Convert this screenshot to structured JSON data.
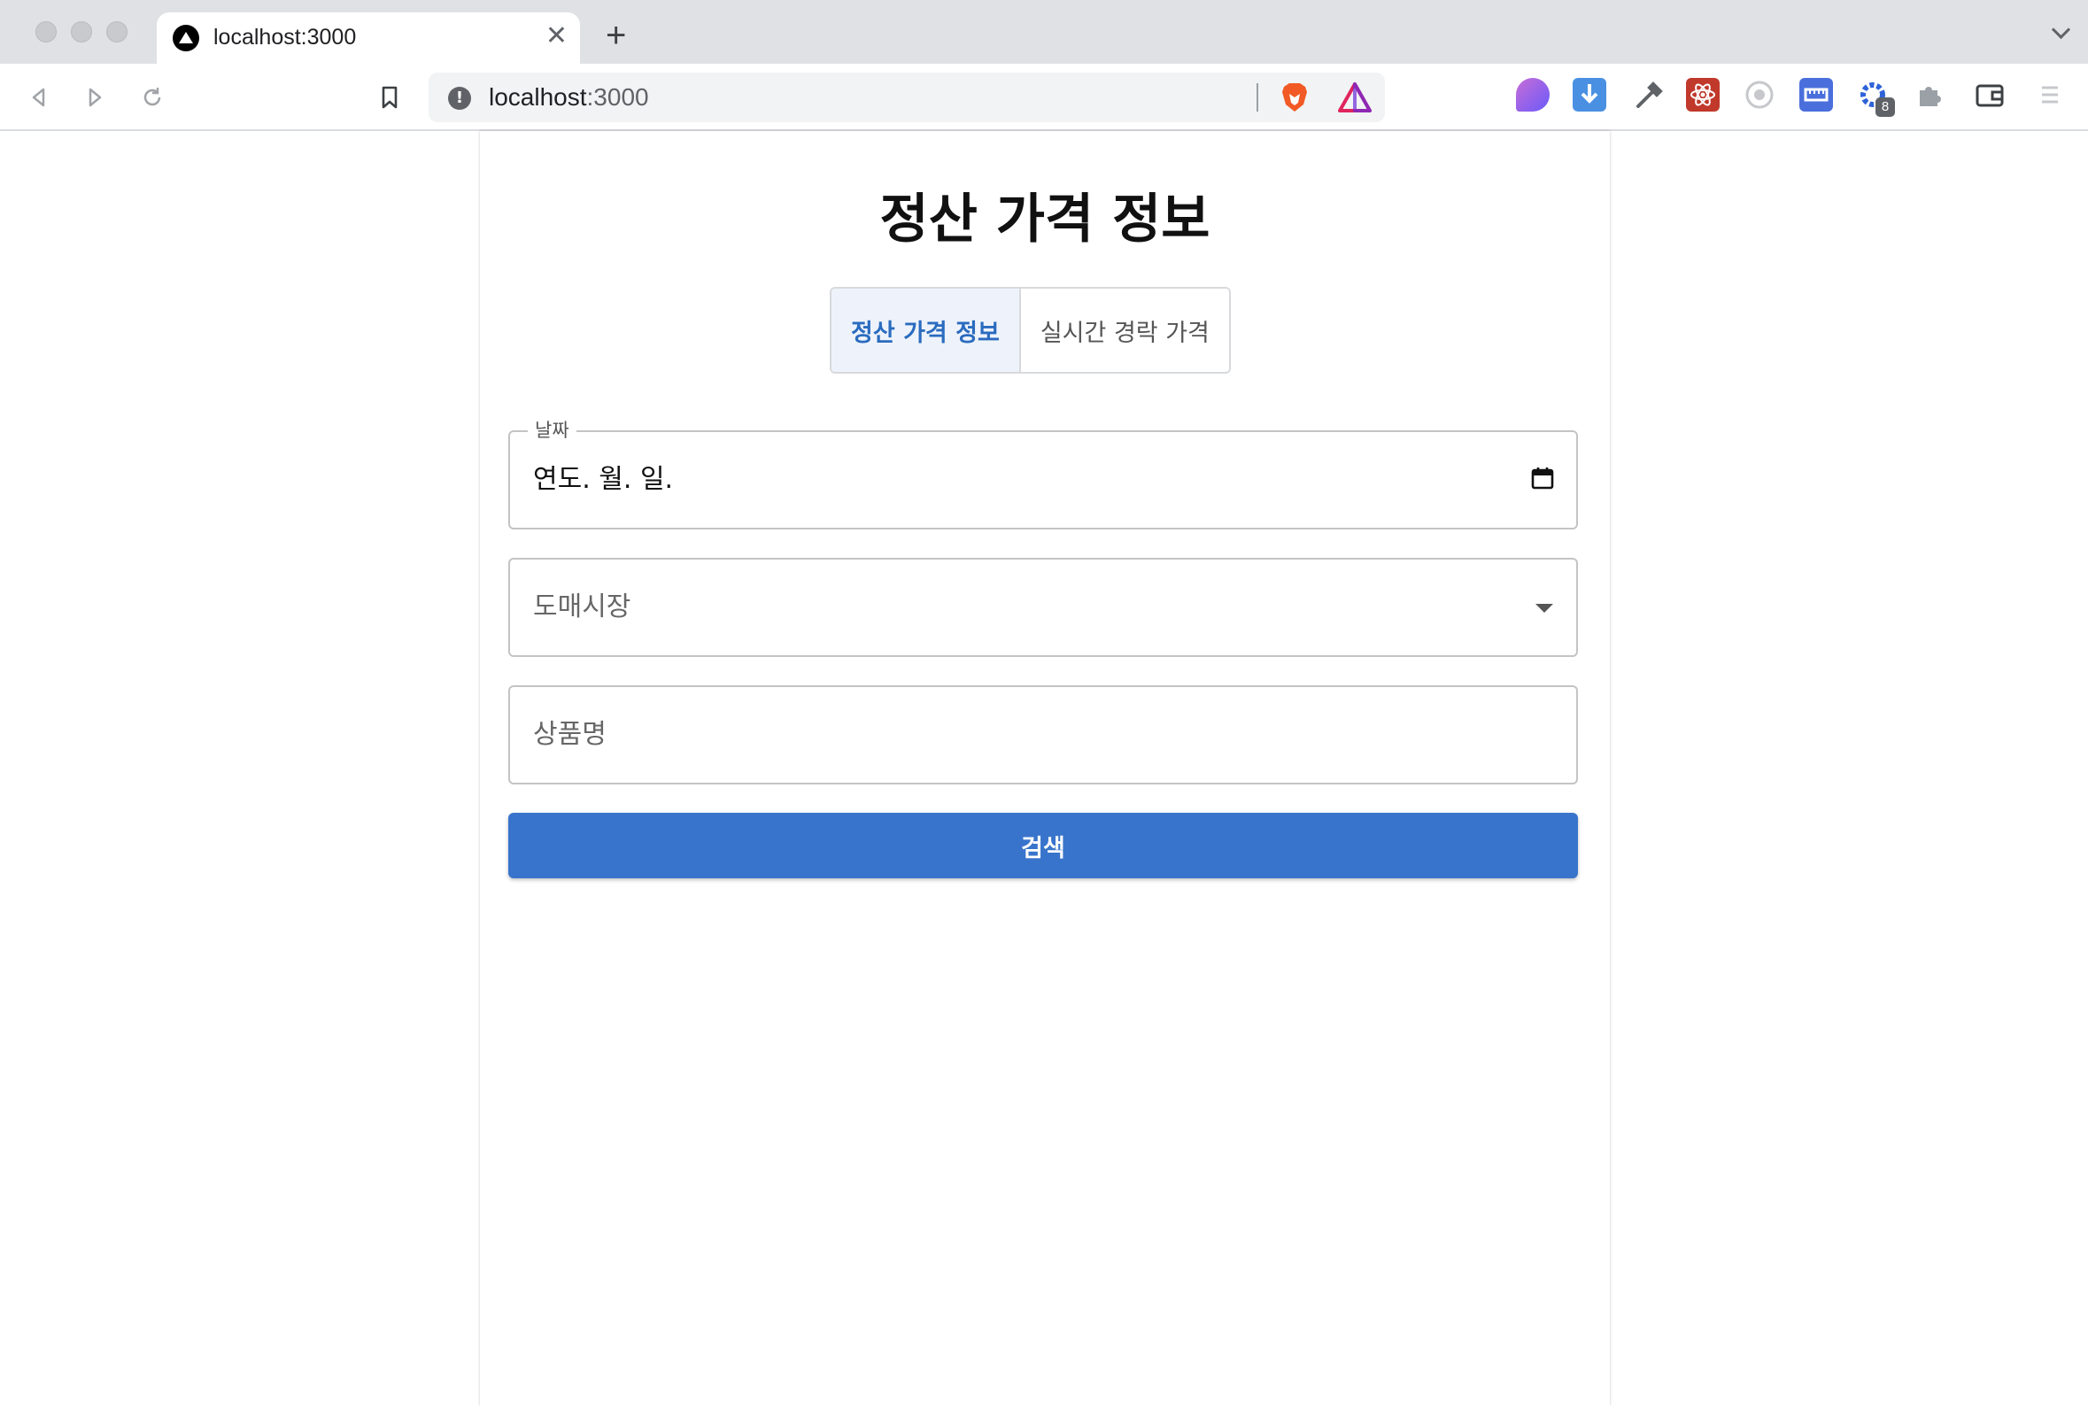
{
  "browser": {
    "tab_title": "localhost:3000",
    "tab_close": "✕",
    "new_tab": "+",
    "url_host": "localhost",
    "url_port": ":3000",
    "extension_badge": "8"
  },
  "page": {
    "title": "정산 가격 정보",
    "toggle": {
      "options": [
        "정산 가격 정보",
        "실시간 경락 가격"
      ],
      "selected": "정산 가격 정보"
    },
    "date_field": {
      "label": "날짜",
      "value": "연도. 월. 일."
    },
    "market_select": {
      "placeholder": "도매시장"
    },
    "product_field": {
      "placeholder": "상품명"
    },
    "search_button": "검색"
  },
  "colors": {
    "accent": "#3874cb",
    "selected_toggle_bg": "#eef3fb",
    "selected_toggle_text": "#2a6bbf"
  }
}
